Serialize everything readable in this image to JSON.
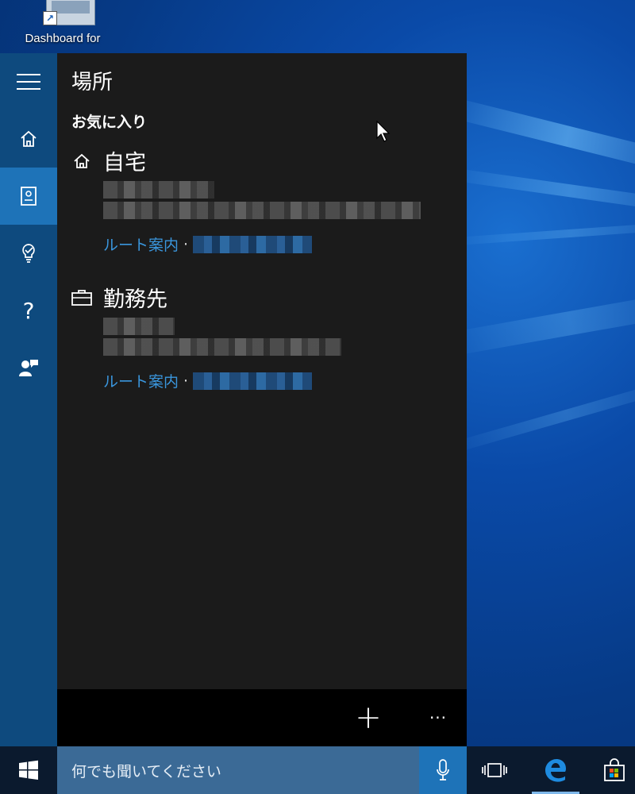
{
  "desktop": {
    "icon_label": "Dashboard for",
    "shortcut_glyph": "↗"
  },
  "panel": {
    "title": "場所",
    "section": "お気に入り",
    "places": [
      {
        "name": "自宅",
        "icon": "home-icon",
        "route_label": "ルート案内",
        "separator": "·"
      },
      {
        "name": "勤務先",
        "icon": "briefcase-icon",
        "route_label": "ルート案内",
        "separator": "·"
      }
    ]
  },
  "rail": {
    "items": [
      {
        "icon": "hamburger-icon"
      },
      {
        "icon": "home-icon"
      },
      {
        "icon": "notebook-icon",
        "active": true
      },
      {
        "icon": "reminder-icon"
      },
      {
        "icon": "help-icon",
        "glyph": "?"
      },
      {
        "icon": "feedback-icon"
      }
    ]
  },
  "bottom_bar": {
    "add_glyph": "+",
    "more_glyph": "···"
  },
  "taskbar": {
    "search_placeholder": "何でも聞いてください"
  },
  "colors": {
    "accent": "#1e73b8",
    "panel_bg": "#1b1b1b",
    "rail_bg": "#0e4a7e",
    "link": "#3a96dd",
    "searchbox_bg": "#3b6a96"
  }
}
